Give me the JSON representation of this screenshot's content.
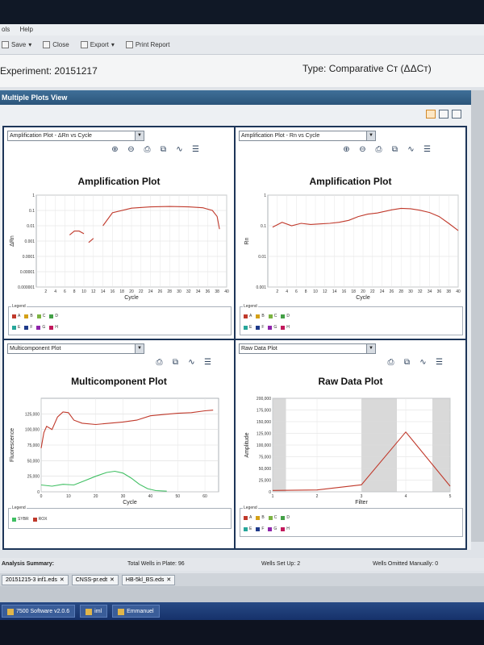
{
  "menu": [
    "ols",
    "Help"
  ],
  "toolbar": {
    "save": "Save",
    "close": "Close",
    "export": "Export",
    "print": "Print Report"
  },
  "experiment": {
    "label": "Experiment:",
    "name": "20151217",
    "type_label": "Type:",
    "type_value": "Comparative Cт (ΔΔCт)"
  },
  "view": {
    "title": "Multiple Plots View"
  },
  "panels": {
    "amp_log": {
      "dropdown": "Amplification Plot - ΔRn vs Cycle",
      "title": "Amplification Plot",
      "ylabel": "ΔRn",
      "xlabel": "Cycle"
    },
    "amp_rn": {
      "dropdown": "Amplification Plot - Rn vs Cycle",
      "title": "Amplification Plot",
      "ylabel": "Rn",
      "xlabel": "Cycle"
    },
    "multi": {
      "dropdown": "Multicomponent Plot",
      "title": "Multicomponent Plot",
      "ylabel": "Fluorescence",
      "xlabel": "Cycle"
    },
    "raw": {
      "dropdown": "Raw Data Plot",
      "title": "Raw Data Plot",
      "ylabel": "Amplitude",
      "xlabel": "Filter"
    }
  },
  "legend": {
    "title": "Legend",
    "wells": [
      {
        "label": "A",
        "color": "#c0392b"
      },
      {
        "label": "B",
        "color": "#d4a017"
      },
      {
        "label": "C",
        "color": "#7cb342"
      },
      {
        "label": "D",
        "color": "#43a047"
      },
      {
        "label": "E",
        "color": "#26a69a"
      },
      {
        "label": "F",
        "color": "#1e3a8a"
      },
      {
        "label": "G",
        "color": "#8e24aa"
      },
      {
        "label": "H",
        "color": "#c2185b"
      }
    ],
    "dyes": [
      {
        "label": "SYBR",
        "color": "#3fbf62"
      },
      {
        "label": "ROX",
        "color": "#c0392b"
      }
    ]
  },
  "summary": {
    "label": "Analysis Summary:",
    "total": "Total Wells in Plate: 96",
    "setup": "Wells Set Up: 2",
    "omitted": "Wells Omitted Manually: 0"
  },
  "file_tabs": [
    "20151215-3 inf1.eds",
    "CNSS-pr.edt",
    "HB-5kl_BS.eds"
  ],
  "taskbar": [
    "7500 Software v2.0.6",
    "iml",
    "Emmanuel"
  ],
  "chart_data": [
    {
      "type": "line",
      "title": "Amplification Plot",
      "xlabel": "Cycle",
      "ylabel": "ΔRn",
      "yscale": "log",
      "xlim": [
        0,
        40
      ],
      "ylim": [
        1e-06,
        1
      ],
      "xticks": [
        2,
        4,
        6,
        8,
        10,
        12,
        14,
        16,
        18,
        20,
        22,
        24,
        26,
        28,
        30,
        32,
        34,
        36,
        38,
        40
      ],
      "yticks": [
        "1",
        "0.1",
        "0.01",
        "0.001",
        "0.0001",
        "0.00001",
        "0.000001"
      ],
      "grid": true,
      "series": [
        {
          "segments": [
            [
              [
                7,
                0.0025
              ],
              [
                8,
                0.0045
              ],
              [
                9,
                0.0045
              ],
              [
                10,
                0.003
              ]
            ],
            [
              [
                11,
                0.0008
              ],
              [
                12,
                0.0015
              ]
            ],
            [
              [
                14,
                0.01
              ],
              [
                16,
                0.07
              ],
              [
                20,
                0.14
              ],
              [
                24,
                0.17
              ],
              [
                28,
                0.18
              ],
              [
                32,
                0.17
              ],
              [
                35,
                0.15
              ],
              [
                37,
                0.1
              ],
              [
                38,
                0.04
              ],
              [
                38.5,
                0.006
              ]
            ]
          ]
        }
      ]
    },
    {
      "type": "line",
      "title": "Amplification Plot",
      "xlabel": "Cycle",
      "ylabel": "Rn",
      "yscale": "log",
      "xlim": [
        0,
        40
      ],
      "ylim": [
        0.001,
        1
      ],
      "xticks": [
        2,
        4,
        6,
        8,
        10,
        12,
        14,
        16,
        18,
        20,
        22,
        24,
        26,
        28,
        30,
        32,
        34,
        36,
        38,
        40
      ],
      "yticks": [
        "1",
        "0.1",
        "0.01",
        "0.001"
      ],
      "grid": true,
      "series": [
        {
          "segments": [
            [
              [
                1,
                0.09
              ],
              [
                3,
                0.13
              ],
              [
                5,
                0.1
              ],
              [
                7,
                0.12
              ],
              [
                9,
                0.11
              ],
              [
                11,
                0.115
              ],
              [
                13,
                0.12
              ],
              [
                15,
                0.13
              ],
              [
                17,
                0.15
              ],
              [
                19,
                0.2
              ],
              [
                21,
                0.24
              ],
              [
                23,
                0.26
              ],
              [
                26,
                0.33
              ],
              [
                28,
                0.37
              ],
              [
                30,
                0.36
              ],
              [
                32,
                0.32
              ],
              [
                34,
                0.27
              ],
              [
                36,
                0.2
              ],
              [
                38,
                0.12
              ],
              [
                40,
                0.07
              ]
            ]
          ]
        }
      ]
    },
    {
      "type": "line",
      "title": "Multicomponent Plot",
      "xlabel": "Cycle",
      "ylabel": "Fluorescence",
      "xlim": [
        0,
        65
      ],
      "ylim": [
        0,
        150000
      ],
      "xticks": [
        0,
        10,
        20,
        30,
        40,
        50,
        60
      ],
      "yticks": [
        "0",
        "25,000",
        "50,000",
        "75,000",
        "100,000",
        "125,000"
      ],
      "grid": true,
      "series": [
        {
          "name": "ROX",
          "color": "#c0392b",
          "values": [
            [
              0,
              70000
            ],
            [
              1,
              95000
            ],
            [
              2,
              105000
            ],
            [
              4,
              100000
            ],
            [
              6,
              120000
            ],
            [
              8,
              128000
            ],
            [
              10,
              127000
            ],
            [
              12,
              115000
            ],
            [
              15,
              110000
            ],
            [
              20,
              108000
            ],
            [
              25,
              110000
            ],
            [
              30,
              112000
            ],
            [
              35,
              115000
            ],
            [
              40,
              122000
            ],
            [
              45,
              124000
            ],
            [
              50,
              126000
            ],
            [
              55,
              127000
            ],
            [
              60,
              130000
            ],
            [
              63,
              131000
            ]
          ]
        },
        {
          "name": "SYBR",
          "color": "#3fbf62",
          "values": [
            [
              0,
              11000
            ],
            [
              4,
              9000
            ],
            [
              8,
              12000
            ],
            [
              12,
              11000
            ],
            [
              16,
              18000
            ],
            [
              20,
              25000
            ],
            [
              24,
              31000
            ],
            [
              27,
              33000
            ],
            [
              30,
              30000
            ],
            [
              33,
              22000
            ],
            [
              36,
              12000
            ],
            [
              39,
              5000
            ],
            [
              42,
              2000
            ],
            [
              46,
              1000
            ]
          ]
        }
      ]
    },
    {
      "type": "line",
      "title": "Raw Data Plot",
      "xlabel": "Filter",
      "ylabel": "Amplitude",
      "xlim": [
        1,
        5
      ],
      "ylim": [
        0,
        200000
      ],
      "xticks": [
        1,
        2,
        3,
        4,
        5
      ],
      "yticks": [
        "0",
        "25,000",
        "50,000",
        "75,000",
        "100,000",
        "125,000",
        "150,000",
        "175,000",
        "200,000"
      ],
      "grid": true,
      "series": [
        {
          "color": "#c0392b",
          "values": [
            [
              1,
              3000
            ],
            [
              2,
              4000
            ],
            [
              3,
              15000
            ],
            [
              4,
              128000
            ],
            [
              5,
              12000
            ]
          ]
        }
      ]
    }
  ]
}
